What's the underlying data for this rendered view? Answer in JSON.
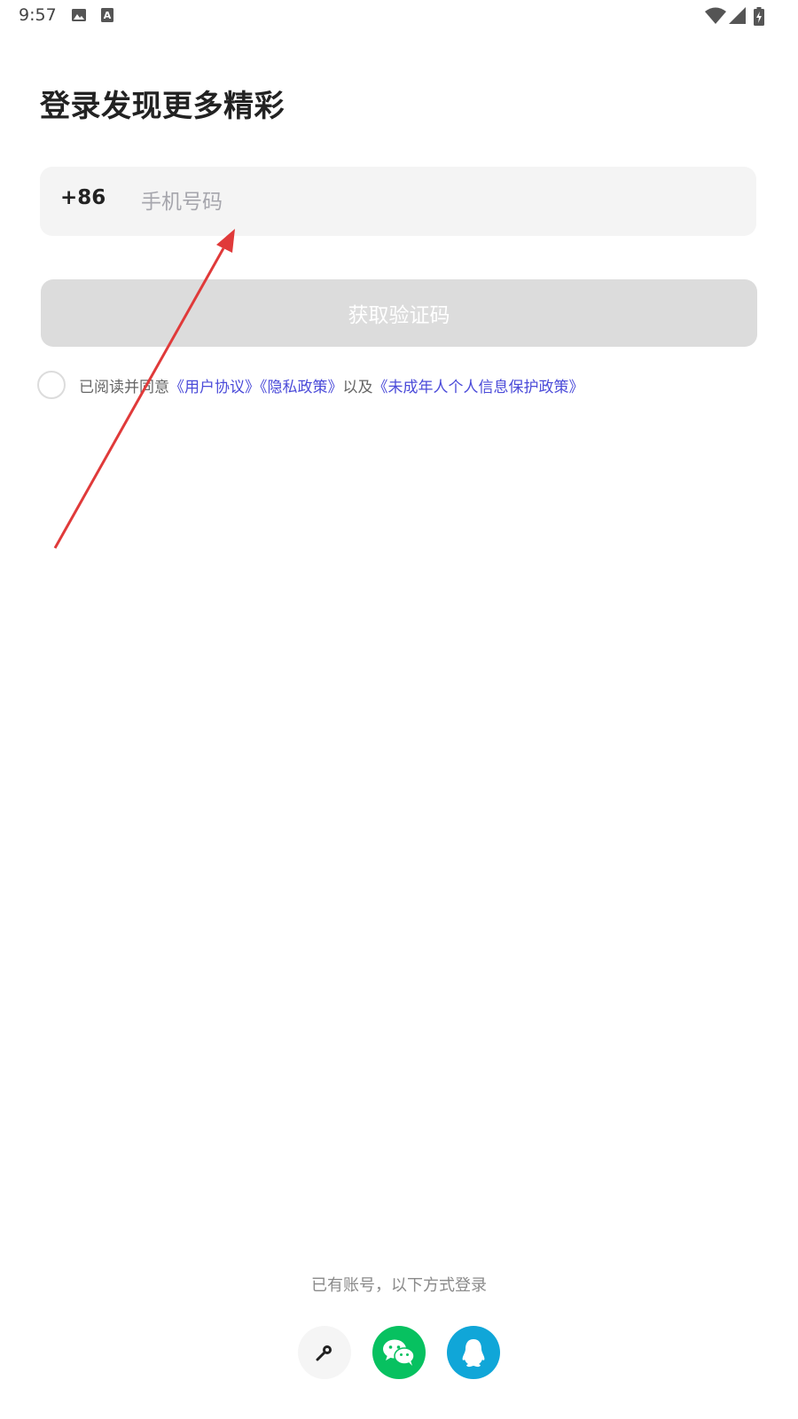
{
  "status_bar": {
    "time": "9:57",
    "icons_left": [
      "image-icon",
      "text-a-icon"
    ],
    "icons_right": [
      "wifi-icon",
      "signal-icon",
      "battery-charging-icon"
    ]
  },
  "page": {
    "title": "登录发现更多精彩"
  },
  "phone": {
    "country_code": "+86",
    "placeholder": "手机号码",
    "value": ""
  },
  "code_button": {
    "label": "获取验证码",
    "enabled": false
  },
  "agreement": {
    "checked": false,
    "prefix": "已阅读并同意",
    "user_agreement": "《用户协议》",
    "privacy_policy": "《隐私政策》",
    "connector": "以及",
    "minor_policy": "《未成年人个人信息保护政策》",
    "link_color": "#4b4bd9"
  },
  "alt_login": {
    "label": "已有账号，以下方式登录",
    "methods": [
      {
        "icon": "key-icon",
        "color": "#f5f5f5"
      },
      {
        "icon": "wechat-icon",
        "color": "#07c160"
      },
      {
        "icon": "qq-icon",
        "color": "#10a6d8"
      }
    ]
  },
  "annotation": {
    "type": "arrow",
    "color": "#e03a3a"
  }
}
